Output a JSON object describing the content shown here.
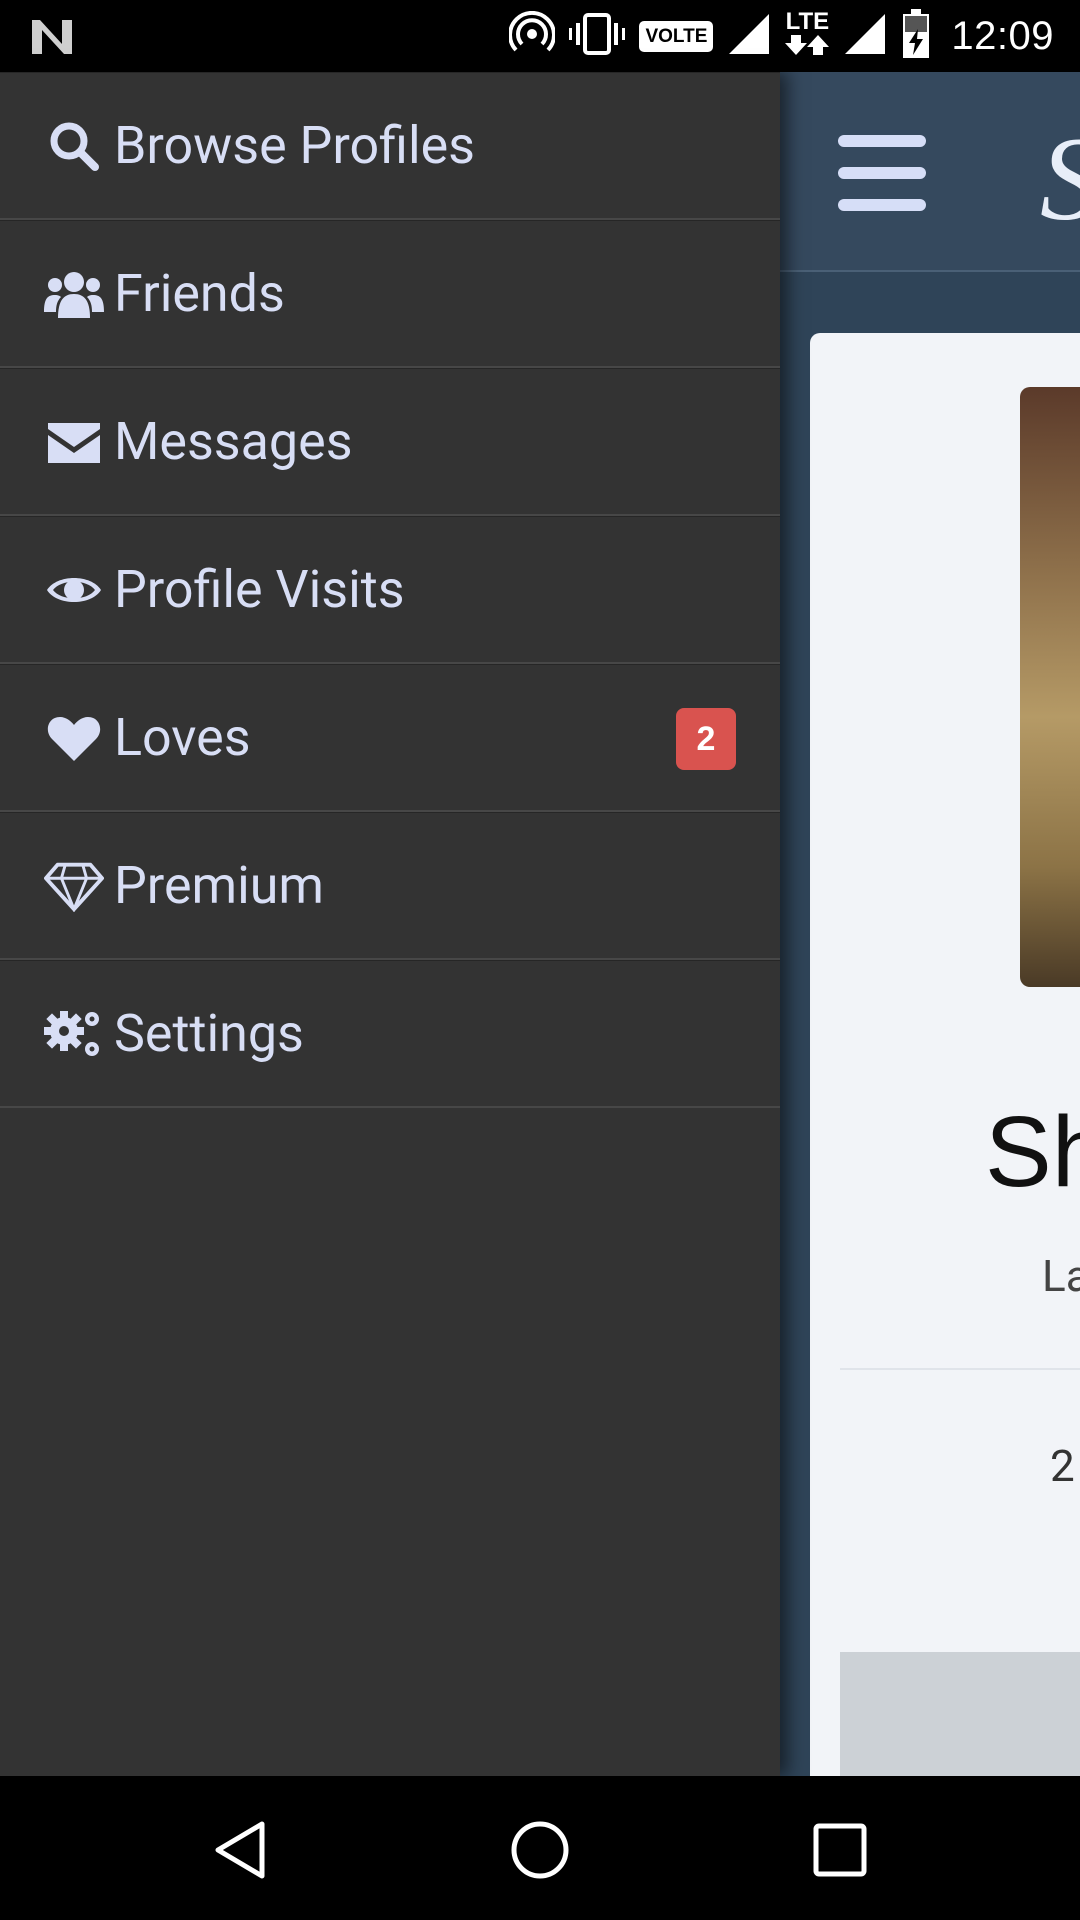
{
  "status_bar": {
    "time": "12:09",
    "volte_label": "VOLTE",
    "lte_label": "LTE",
    "icons": [
      "n-logo-icon",
      "hotspot-icon",
      "vibrate-icon",
      "volte-icon",
      "signal-icon",
      "lte-icon",
      "signal-icon",
      "battery-charging-icon"
    ]
  },
  "drawer": {
    "items": [
      {
        "label": "Browse Profiles",
        "icon": "search-icon"
      },
      {
        "label": "Friends",
        "icon": "users-icon"
      },
      {
        "label": "Messages",
        "icon": "envelope-icon"
      },
      {
        "label": "Profile Visits",
        "icon": "eye-icon"
      },
      {
        "label": "Loves",
        "icon": "heart-icon",
        "badge": "2"
      },
      {
        "label": "Premium",
        "icon": "diamond-icon"
      },
      {
        "label": "Settings",
        "icon": "gears-icon"
      }
    ]
  },
  "background": {
    "logo_partial": "S",
    "profile_name_partial": "Sh",
    "profile_sub_partial": "La",
    "profile_number_partial": "2"
  },
  "nav": {
    "buttons": [
      "back-icon",
      "home-icon",
      "recents-icon"
    ]
  },
  "colors": {
    "drawer_bg": "#333333",
    "drawer_text": "#d8def5",
    "badge": "#d9534f",
    "header_bg": "#35495e"
  }
}
